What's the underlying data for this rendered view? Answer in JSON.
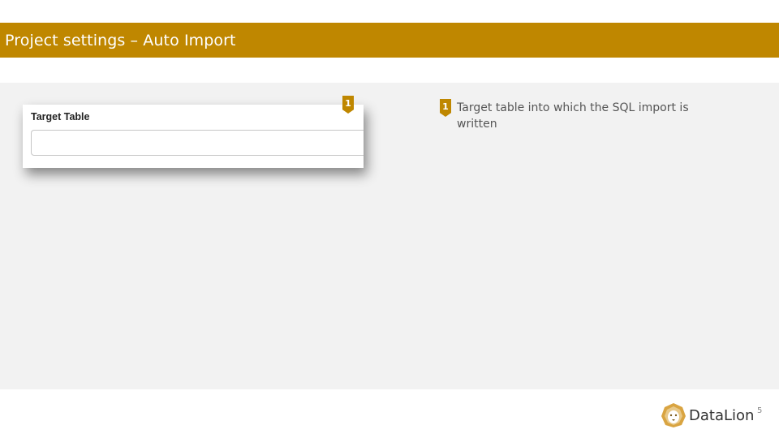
{
  "header": {
    "title": "Project settings – Auto Import"
  },
  "form": {
    "target_table_label": "Target Table",
    "target_table_value": ""
  },
  "annotations": [
    {
      "number": "1",
      "text": "Target table into which the SQL import is written"
    }
  ],
  "footer": {
    "brand": "DataLion",
    "page_number": "5"
  },
  "colors": {
    "accent": "#bf8700",
    "content_background": "#f2f2f2"
  }
}
